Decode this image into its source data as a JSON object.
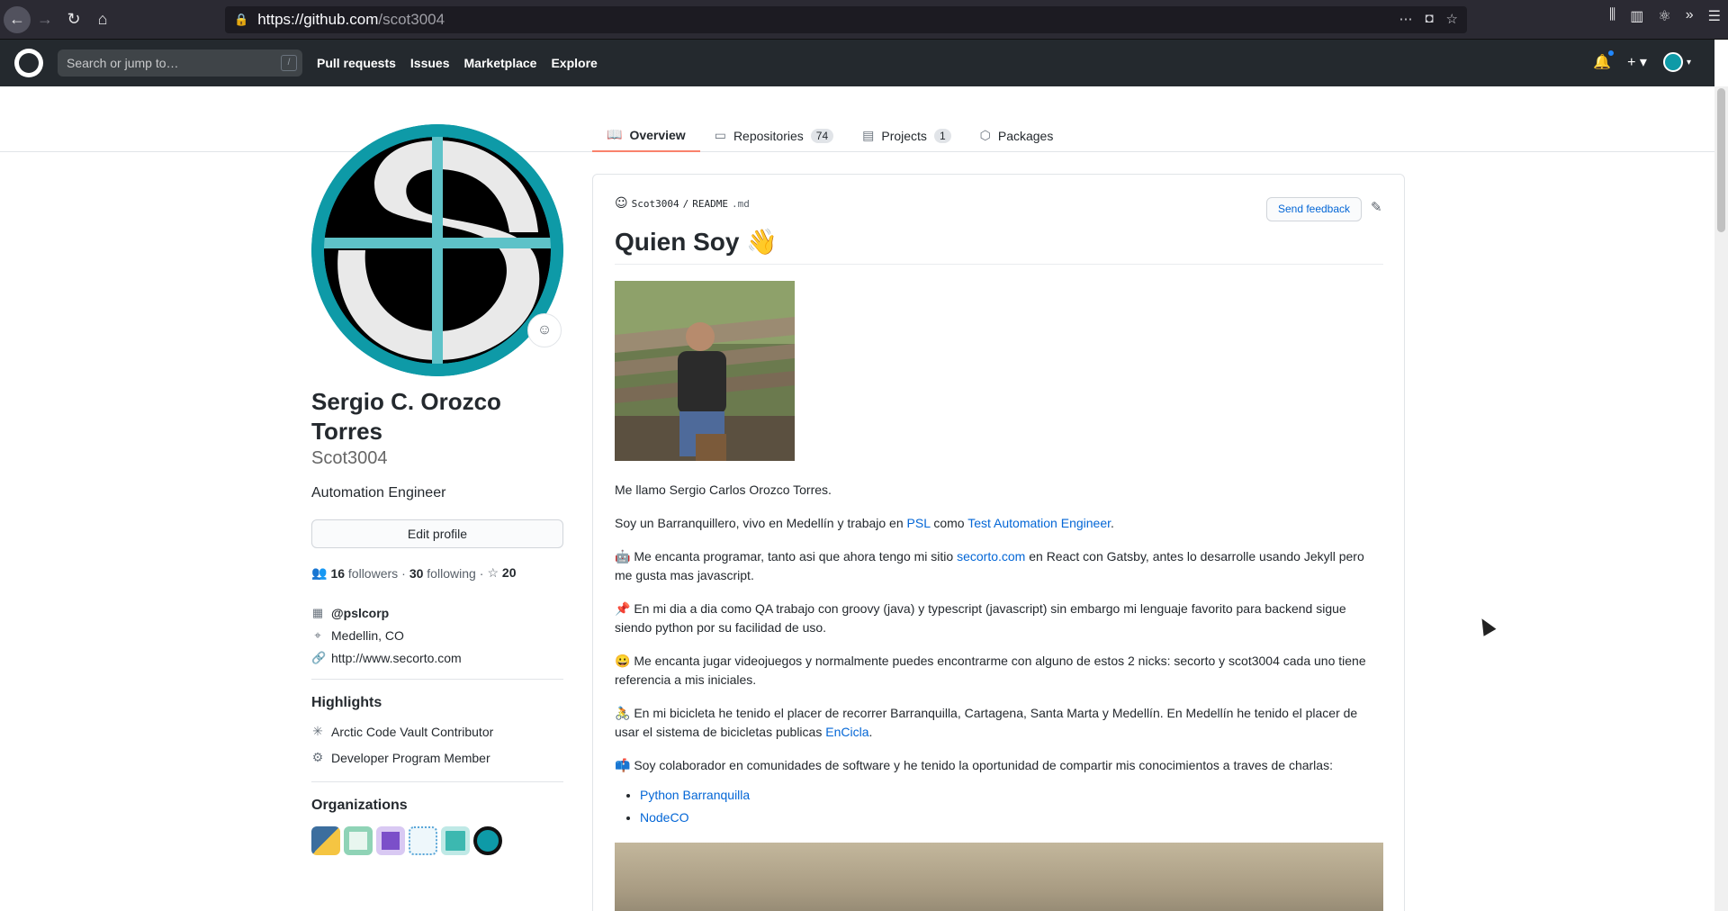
{
  "browser": {
    "url_host": "https://github.com",
    "url_path": "/scot3004"
  },
  "header": {
    "search_placeholder": "Search or jump to…",
    "search_shortcut": "/",
    "nav": [
      "Pull requests",
      "Issues",
      "Marketplace",
      "Explore"
    ],
    "plus": "+ ▾"
  },
  "tabs": [
    {
      "label": "Overview",
      "count": null,
      "icon": "book-icon"
    },
    {
      "label": "Repositories",
      "count": "74",
      "icon": "repo-icon"
    },
    {
      "label": "Projects",
      "count": "1",
      "icon": "project-icon"
    },
    {
      "label": "Packages",
      "count": null,
      "icon": "package-icon"
    }
  ],
  "profile": {
    "full_name": "Sergio C. Orozco Torres",
    "login": "Scot3004",
    "bio": "Automation Engineer",
    "edit_label": "Edit profile",
    "followers_count": "16",
    "followers_label": "followers",
    "following_count": "30",
    "following_label": "following",
    "stars_count": "20",
    "company": "@pslcorp",
    "location": "Medellin, CO",
    "website": "http://www.secorto.com"
  },
  "highlights": {
    "title": "Highlights",
    "items": [
      "Arctic Code Vault Contributor",
      "Developer Program Member"
    ]
  },
  "organizations": {
    "title": "Organizations",
    "colors": [
      "#3c6e9e",
      "#8fd3b6",
      "#7b4fc9",
      "#5aa6d8",
      "#3cb8b0",
      "#0e9aa7"
    ]
  },
  "readme": {
    "owner": "Scot3004",
    "sep": "/",
    "file": "README",
    "ext": ".md",
    "feedback": "Send feedback",
    "title": "Quien Soy 👋",
    "p1": "Me llamo Sergio Carlos Orozco Torres.",
    "p2_pre": "Soy un Barranquillero, vivo en Medellín y trabajo en ",
    "p2_link1": "PSL",
    "p2_mid": " como ",
    "p2_link2": "Test Automation Engineer",
    "p2_post": ".",
    "p3_pre": "🤖 Me encanta programar, tanto asi que ahora tengo mi sitio ",
    "p3_link": "secorto.com",
    "p3_post": " en React con Gatsby, antes lo desarrolle usando Jekyll pero me gusta mas javascript.",
    "p4": "📌 En mi dia a dia como QA trabajo con groovy (java) y typescript (javascript) sin embargo mi lenguaje favorito para backend sigue siendo python por su facilidad de uso.",
    "p5": "😀 Me encanta jugar videojuegos y normalmente puedes encontrarme con alguno de estos 2 nicks: secorto y scot3004 cada uno tiene referencia a mis iniciales.",
    "p6_pre": "🚴 En mi bicicleta he tenido el placer de recorrer Barranquilla, Cartagena, Santa Marta y Medellín. En Medellín he tenido el placer de usar el sistema de bicicletas publicas ",
    "p6_link": "EnCicla",
    "p6_post": ".",
    "p7": "📫 Soy colaborador en comunidades de software y he tenido la oportunidad de compartir mis conocimientos a traves de charlas:",
    "list": [
      "Python Barranquilla",
      "NodeCO"
    ]
  }
}
